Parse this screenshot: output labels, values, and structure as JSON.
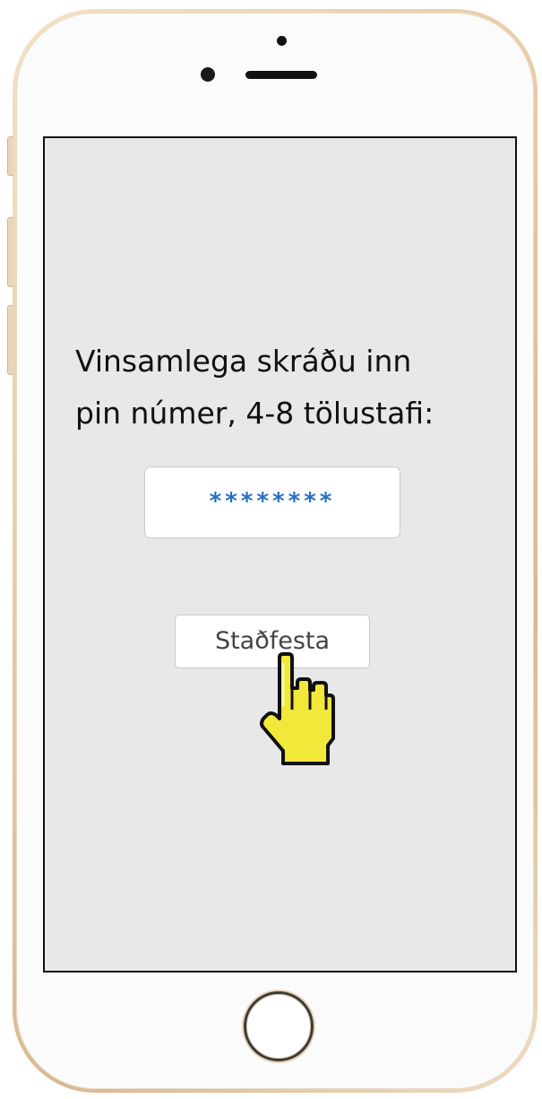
{
  "screen": {
    "prompt_line1": "Vinsamlega skráðu inn",
    "prompt_line2": "pin númer, 4-8 tölustafi:",
    "pin_value": "********",
    "confirm_label": "Staðfesta"
  },
  "icons": {
    "cursor": "hand-pointer-icon",
    "home": "home-button-icon",
    "camera": "camera-icon",
    "speaker": "speaker-icon"
  },
  "colors": {
    "screen_background": "#e8e8e8",
    "pin_text": "#2a6fc4",
    "cursor_fill": "#f2e83a",
    "frame_gold": "#e6c9a3"
  }
}
